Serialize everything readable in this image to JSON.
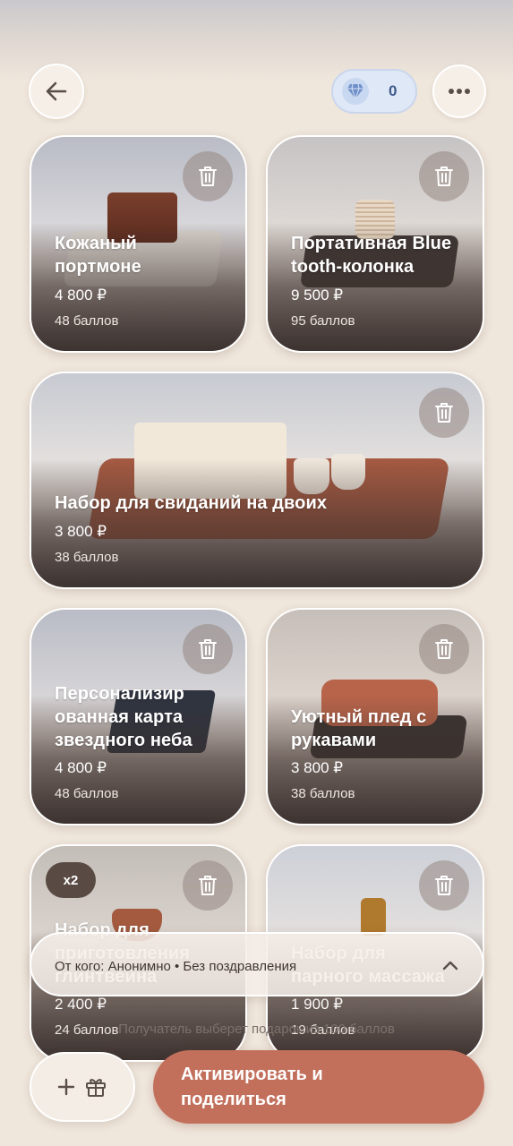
{
  "header": {
    "points_value": "0",
    "icons": {
      "back": "arrow-left-icon",
      "points": "diamond-icon",
      "more": "more-horizontal-icon"
    }
  },
  "gifts": [
    {
      "title": "Кожаный портмоне",
      "price": "4 800 ₽",
      "points": "48 баллов"
    },
    {
      "title": "Портативная Bluetooth-колонка",
      "price": "9 500 ₽",
      "points": "95 баллов"
    },
    {
      "title": "Набор для свиданий на двоих",
      "price": "3 800 ₽",
      "points": "38 баллов"
    },
    {
      "title": "Персонализированная карта звездного неба",
      "price": "4 800 ₽",
      "points": "48 баллов"
    },
    {
      "title": "Уютный плед с рукавами",
      "price": "3 800 ₽",
      "points": "38 баллов"
    },
    {
      "title": "Набор для приготовления глинтвейна",
      "price": "2 400 ₽",
      "points": "24 баллов",
      "quantity": "x2"
    },
    {
      "title": "Набор для парного массажа",
      "price": "1 900 ₽",
      "points": "19 баллов"
    }
  ],
  "sender_bar": {
    "text": "От кого: Анонимно • Без поздравления"
  },
  "hint": "Получатель выберет подарок из 100 баллов",
  "actions": {
    "activate_line1": "Активировать и",
    "activate_line2": "поделиться"
  },
  "colors": {
    "accent": "#c2705c",
    "background": "#efe6dc",
    "points_pill": "#dfe8f6"
  }
}
